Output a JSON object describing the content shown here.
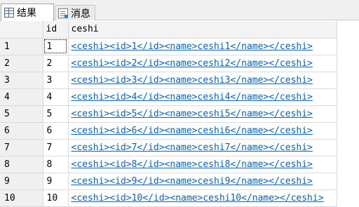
{
  "tabs": [
    {
      "label": "结果",
      "icon": "grid-icon"
    },
    {
      "label": "消息",
      "icon": "messages-icon"
    }
  ],
  "grid": {
    "columns": [
      "",
      "id",
      "ceshi"
    ],
    "rows": [
      {
        "num": "1",
        "id": "1",
        "ceshi": "<ceshi><id>1</id><name>ceshi1</name></ceshi>"
      },
      {
        "num": "2",
        "id": "2",
        "ceshi": "<ceshi><id>2</id><name>ceshi2</name></ceshi>"
      },
      {
        "num": "3",
        "id": "3",
        "ceshi": "<ceshi><id>3</id><name>ceshi3</name></ceshi>"
      },
      {
        "num": "4",
        "id": "4",
        "ceshi": "<ceshi><id>4</id><name>ceshi4</name></ceshi>"
      },
      {
        "num": "5",
        "id": "5",
        "ceshi": "<ceshi><id>5</id><name>ceshi5</name></ceshi>"
      },
      {
        "num": "6",
        "id": "6",
        "ceshi": "<ceshi><id>6</id><name>ceshi6</name></ceshi>"
      },
      {
        "num": "7",
        "id": "7",
        "ceshi": "<ceshi><id>7</id><name>ceshi7</name></ceshi>"
      },
      {
        "num": "8",
        "id": "8",
        "ceshi": "<ceshi><id>8</id><name>ceshi8</name></ceshi>"
      },
      {
        "num": "9",
        "id": "9",
        "ceshi": "<ceshi><id>9</id><name>ceshi9</name></ceshi>"
      },
      {
        "num": "10",
        "id": "10",
        "ceshi": "<ceshi><id>10</id><name>ceshi10</name></ceshi>"
      }
    ]
  },
  "colors": {
    "link": "#0563c1",
    "header_bg": "#f3f3f3",
    "gridline": "#d9d9d9"
  }
}
